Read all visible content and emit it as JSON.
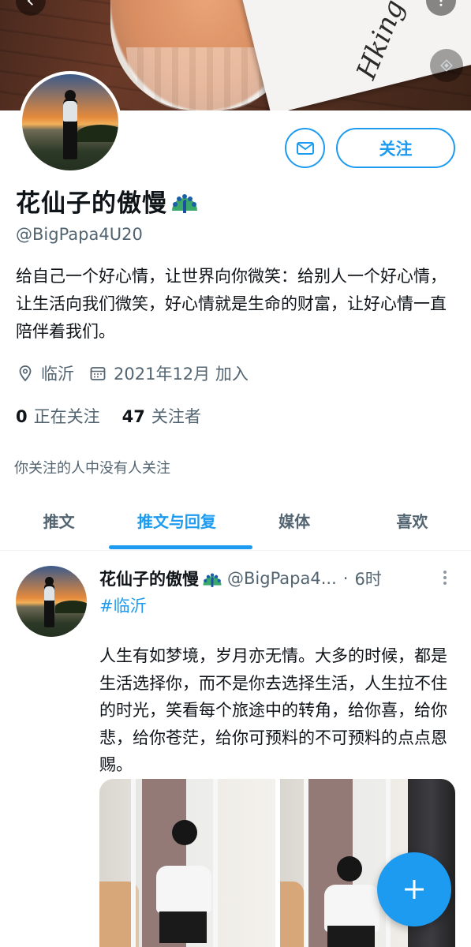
{
  "profile": {
    "name": "花仙子的傲慢",
    "handle": "@BigPapa4U20",
    "bio": "给自己一个好心情，让世界向你微笑：给别人一个好心情，让生活向我们微笑，好心情就是生命的财富，让好心情一直陪伴着我们。",
    "location": "临沂",
    "joined": "2021年12月 加入",
    "following_count": "0",
    "following_label": "正在关注",
    "followers_count": "47",
    "followers_label": "关注者",
    "mutual_note": "你关注的人中没有人关注"
  },
  "actions": {
    "follow_label": "关注"
  },
  "tabs": [
    {
      "label": "推文",
      "active": false
    },
    {
      "label": "推文与回复",
      "active": true
    },
    {
      "label": "媒体",
      "active": false
    },
    {
      "label": "喜欢",
      "active": false
    }
  ],
  "tweet": {
    "name": "花仙子的傲慢",
    "handle": "@BigPapa4...",
    "separator": "·",
    "time": "6时",
    "hashtag": "#临沂",
    "text": "人生有如梦境，岁月亦无情。大多的时候，都是生活选择你，而不是你去选择生活，人生拉不住的时光，笑看每个旅途中的转角，给你喜，给你悲，给你苍茫，给你可预料的不可预料的点点恩赐。"
  },
  "colors": {
    "accent": "#1d9bf0",
    "text_primary": "#0f1419",
    "text_secondary": "#536471"
  },
  "icons": [
    "back-arrow-icon",
    "more-vertical-icon",
    "translate-icon",
    "mail-icon",
    "peacock-emoji-icon",
    "location-pin-icon",
    "calendar-icon",
    "compose-plus-icon"
  ]
}
